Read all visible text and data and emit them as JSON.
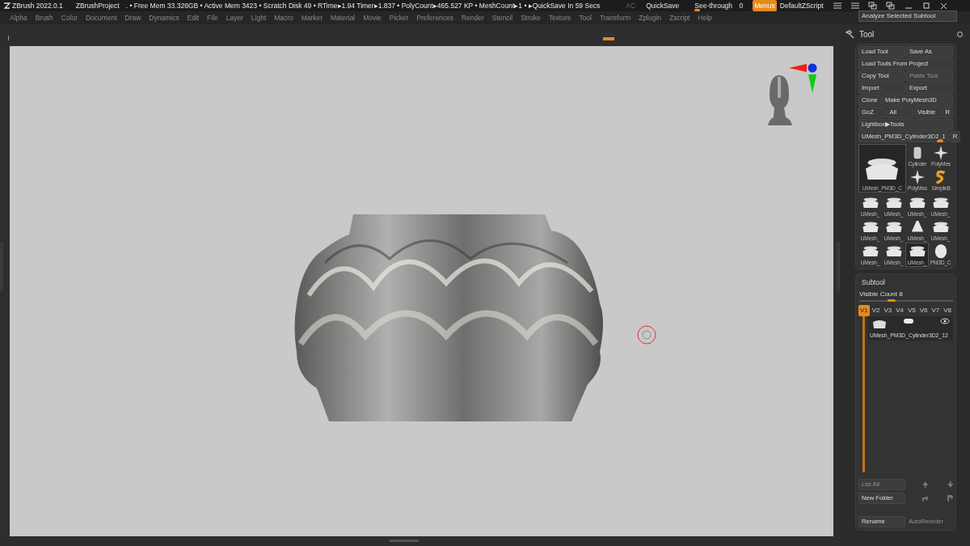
{
  "title_bar": {
    "app": "ZBrush 2022.0.1",
    "project": "ZBrushProject",
    "stats": ". • Free Mem 33.326GB • Active Mem 3423 • Scratch Disk 49 •  RTime▸1.94 Timer▸1.837 • PolyCount▸465.527 KP • MeshCount▸1 • ▸QuickSave In 59 Secs",
    "ac": {
      "label": "AC",
      "disabled": true
    },
    "quicksave": "QuickSave",
    "see_through": {
      "label": "See-through",
      "value": "0",
      "level": 0.12
    },
    "menus_toggle": {
      "label": "Menus",
      "on": true
    },
    "script": "DefaultZScript"
  },
  "menus": [
    "Alpha",
    "Brush",
    "Color",
    "Document",
    "Draw",
    "Dynamics",
    "Edit",
    "File",
    "Layer",
    "Light",
    "Macro",
    "Marker",
    "Material",
    "Movie",
    "Picker",
    "Preferences",
    "Render",
    "Stencil",
    "Stroke",
    "Texture",
    "Tool",
    "Transform",
    "Zplugin",
    "Zscript",
    "Help"
  ],
  "popup": "Analyze Selected Subtool",
  "tool_panel": {
    "title": "Tool",
    "rows": [
      [
        {
          "label": "Load Tool",
          "disabled": false
        },
        {
          "label": "Save As",
          "disabled": false
        }
      ],
      [
        {
          "label": "Load Tools From Project",
          "disabled": false
        }
      ],
      [
        {
          "label": "Copy Tool",
          "disabled": false
        },
        {
          "label": "Paste Tool",
          "disabled": true
        }
      ],
      [
        {
          "label": "Import",
          "disabled": false
        },
        {
          "label": "Export",
          "disabled": false
        }
      ],
      [
        {
          "label": "Clone",
          "disabled": false
        },
        {
          "label": "Make PolyMesh3D",
          "disabled": false
        }
      ],
      [
        {
          "label": "GoZ",
          "disabled": false
        },
        {
          "label": "All",
          "disabled": false
        },
        {
          "label": "Visible",
          "disabled": false
        },
        {
          "label": "R",
          "disabled": false
        }
      ],
      [
        {
          "label": "Lightbox▶Tools",
          "disabled": false
        }
      ]
    ],
    "current_tool": {
      "name": "UMesh_PM3D_Cylinder3D2_1",
      "r": "R",
      "level": 0.95
    },
    "main_thumb": {
      "label": "UMesh_PM3D_C",
      "kind": "mesh"
    },
    "small_thumbs": [
      {
        "label": "Cylinder",
        "kind": "cylinder"
      },
      {
        "label": "PolyMes",
        "kind": "star"
      },
      {
        "label": "PolyMes",
        "kind": "star"
      },
      {
        "label": "SimpleB",
        "kind": "s-logo"
      }
    ],
    "thumbs": [
      {
        "label": "UMesh_",
        "kind": "mesh",
        "selected": false
      },
      {
        "label": "UMesh_",
        "kind": "mesh",
        "selected": false
      },
      {
        "label": "UMesh_",
        "kind": "mesh",
        "selected": false
      },
      {
        "label": "UMesh_",
        "kind": "mesh",
        "selected": false
      },
      {
        "label": "UMesh_",
        "kind": "mesh",
        "selected": false
      },
      {
        "label": "UMesh_",
        "kind": "mesh",
        "selected": false
      },
      {
        "label": "UMesh_",
        "kind": "vase",
        "selected": false
      },
      {
        "label": "UMesh_",
        "kind": "mesh",
        "selected": false
      },
      {
        "label": "UMesh_",
        "kind": "mesh",
        "selected": false
      },
      {
        "label": "UMesh_",
        "kind": "mesh",
        "selected": false
      },
      {
        "label": "UMesh_",
        "kind": "mesh",
        "selected": true
      },
      {
        "label": "PM3D_C",
        "kind": "sphere",
        "selected": false
      }
    ]
  },
  "subtool": {
    "title": "Subtool",
    "visible_count": {
      "label": "Visible Count 8",
      "level": 0.35
    },
    "versions": [
      {
        "label": "V1",
        "selected": true
      },
      {
        "label": "V2",
        "selected": false
      },
      {
        "label": "V3",
        "selected": false
      },
      {
        "label": "V4",
        "selected": false
      },
      {
        "label": "V5",
        "selected": false
      },
      {
        "label": "V6",
        "selected": false
      },
      {
        "label": "V7",
        "selected": false
      },
      {
        "label": "V8",
        "selected": false
      }
    ],
    "items": [
      {
        "name": "UMesh_PM3D_Cylinder3D2_12"
      }
    ],
    "list_all": {
      "label": "List All",
      "disabled": true
    },
    "new_folder": {
      "label": "New Folder",
      "disabled": false
    },
    "rename": {
      "label": "Rename",
      "disabled": false
    },
    "auto_reorder": {
      "label": "AutoReorder",
      "disabled": true
    }
  }
}
